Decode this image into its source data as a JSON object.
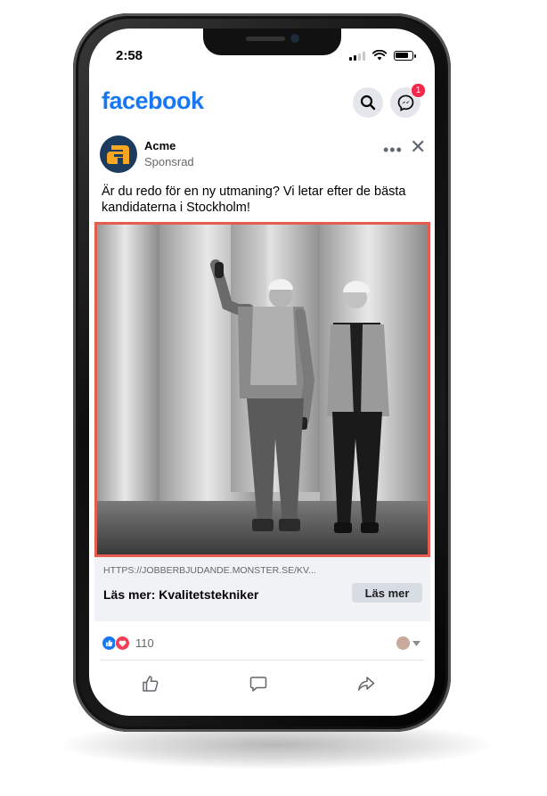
{
  "status_bar": {
    "time": "2:58"
  },
  "header": {
    "logo": "facebook",
    "messenger_badge": "1"
  },
  "post": {
    "page_name": "Acme",
    "sponsored_label": "Sponsrad",
    "text": "Är du redo för en ny utmaning? Vi letar efter de bästa kandidaterna i Stockholm!",
    "link_url": "HTTPS://JOBBERBJUDANDE.MONSTER.SE/KV...",
    "link_title": "Läs mer: Kvalitetstekniker",
    "cta_label": "Läs mer",
    "reaction_count": "110"
  },
  "colors": {
    "brand": "#1877f2",
    "image_border": "#e45d4e",
    "badge": "#f02849",
    "avatar_bg": "#1c3b5e",
    "avatar_accent": "#f5a623"
  },
  "icons": [
    "search-icon",
    "messenger-icon",
    "more-icon",
    "close-icon",
    "like-reaction-icon",
    "love-reaction-icon",
    "like-icon",
    "comment-icon",
    "share-icon"
  ]
}
